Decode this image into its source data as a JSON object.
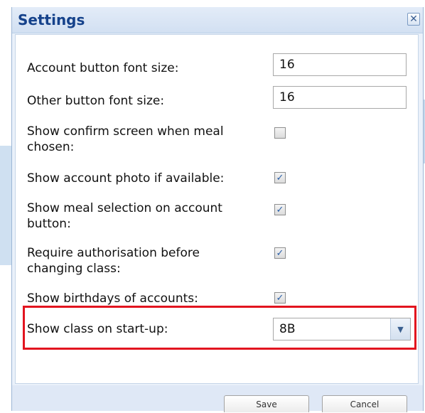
{
  "dialog": {
    "title": "Settings",
    "close_glyph": "✕"
  },
  "fields": {
    "account_font_size": {
      "label": "Account button font size:",
      "value": "16"
    },
    "other_font_size": {
      "label": "Other button font size:",
      "value": "16"
    },
    "confirm_screen": {
      "label_line1": "Show confirm screen when meal",
      "label_line2": "chosen:",
      "checked": false
    },
    "account_photo": {
      "label": "Show account photo if available:",
      "checked": true
    },
    "meal_selection": {
      "label_line1": "Show meal selection on account",
      "label_line2": "button:",
      "checked": true
    },
    "require_auth": {
      "label_line1": "Require authorisation before",
      "label_line2": "changing class:",
      "checked": true
    },
    "birthdays": {
      "label": "Show birthdays of accounts:",
      "checked": true
    },
    "startup_class": {
      "label": "Show class on start-up:",
      "value": "8B"
    }
  },
  "check_glyph": "✓",
  "dropdown_glyph": "▼",
  "buttons": {
    "save": "Save",
    "cancel": "Cancel"
  },
  "colors": {
    "title": "#15428b",
    "highlight": "#e2141f",
    "check": "#2b5fa7"
  }
}
